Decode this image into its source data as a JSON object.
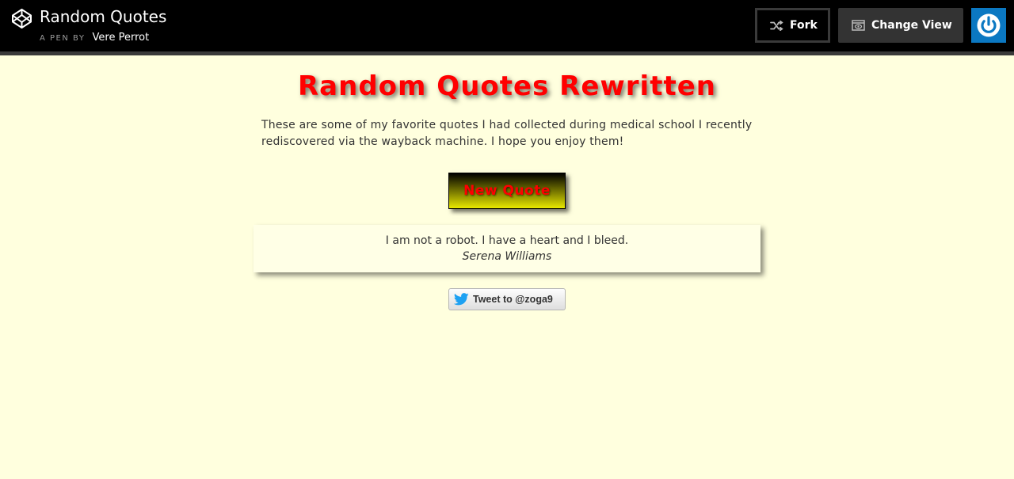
{
  "header": {
    "pen_title": "Random Quotes",
    "pen_by_label": "A PEN BY",
    "author": "Vere Perrot",
    "fork_label": "Fork",
    "change_view_label": "Change View",
    "icons": {
      "logo": "codepen-logo-icon",
      "fork": "fork-icon",
      "change_view": "change-view-icon",
      "login": "power-icon"
    },
    "colors": {
      "bar": "#000000",
      "login_button": "#0b78c2"
    }
  },
  "main": {
    "heading": "Random Quotes Rewritten",
    "intro": "These are some of my favorite quotes I had collected during medical school I recently rediscovered via the wayback machine. I hope you enjoy them!",
    "new_quote_label": "New Quote",
    "quote": {
      "text": "I am not a robot. I have a heart and I bleed.",
      "author": "Serena Williams"
    },
    "tweet_label": "Tweet to @zoga9",
    "tweet_icon": "twitter-bird-icon",
    "colors": {
      "background": "#ffffde",
      "heading": "#ff0000",
      "button_text": "#ff0000"
    }
  }
}
